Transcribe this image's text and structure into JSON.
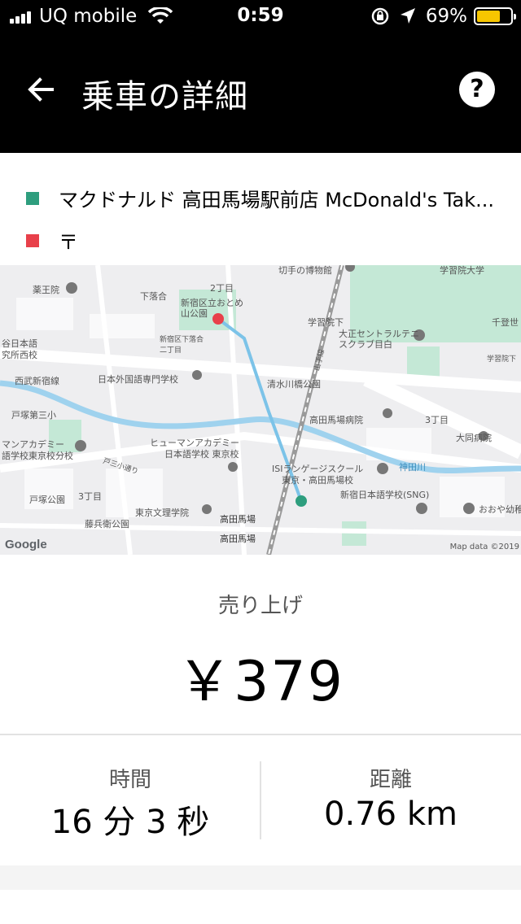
{
  "status_bar": {
    "carrier": "UQ mobile",
    "time": "0:59",
    "battery": "69%",
    "battery_level": 0.69,
    "battery_color": "#f7c600"
  },
  "header": {
    "title": "乗車の詳細",
    "back_icon": "arrow-left-icon",
    "help_icon": "question-icon",
    "help_glyph": "?"
  },
  "route": {
    "pickup": {
      "label": "マクドナルド 高田馬場駅前店 McDonald's Tak...",
      "color": "#2e9e7e"
    },
    "dropoff": {
      "label": "〒",
      "color": "#e8404a"
    }
  },
  "map": {
    "labels": {
      "kiriganami": "切手の博物館",
      "gakushuin": "学習院大学",
      "yakuo": "薬王院",
      "shimoochiai": "下落合",
      "nichome": "2丁目",
      "park": "新宿区立おとめ山公園",
      "gakushuin_st": "学習院下",
      "chitose": "千登世",
      "taisho": "大正セントラルテニスクラブ目白",
      "mejiro_left": "谷日本語",
      "research": "究所西校",
      "shimoochiai2": "新宿区下落合二丁目",
      "gakushuin2": "学習院下",
      "seibu": "西武新宿線",
      "nihongaikokugo": "日本外国語専門学校",
      "shimizugawa": "清水川橋公園",
      "totsuka3": "戸塚第三小",
      "hospital": "高田馬場病院",
      "sanchome": "3丁目",
      "daido": "大同病院",
      "humanacademy_l": "マンアカデミー",
      "humanacademy_tokyo": "語学校東京校分校",
      "humanacademy": "ヒューマンアカデミー",
      "humanacademy2": "日本語学校 東京校",
      "totsuka_road": "戸三小通り",
      "isi": "ISIランゲージスクール",
      "isi2": "東京・高田馬場校",
      "kanda": "神田川",
      "totsuka_park": "戸塚公園",
      "sanchome2": "3丁目",
      "shinjuku_jp": "新宿日本語学校(SNG)",
      "oyake": "おおや幼稚",
      "tobe": "藤兵衛公園",
      "tokyo_bunri": "東京文理学院",
      "takadanobaba_st": "高田馬場",
      "takadanobaba": "高田馬場",
      "yamanote": "山手線",
      "google": "Google",
      "attribution": "Map data ©2019"
    },
    "route_color": "#7cc3e8",
    "water_color": "#9fd2ee",
    "park_color": "#c4e8d6"
  },
  "fare": {
    "label": "売り上げ",
    "value": "￥379"
  },
  "stats": {
    "time_label": "時間",
    "time_value": "16 分 3 秒",
    "distance_label": "距離",
    "distance_value": "0.76 km"
  }
}
